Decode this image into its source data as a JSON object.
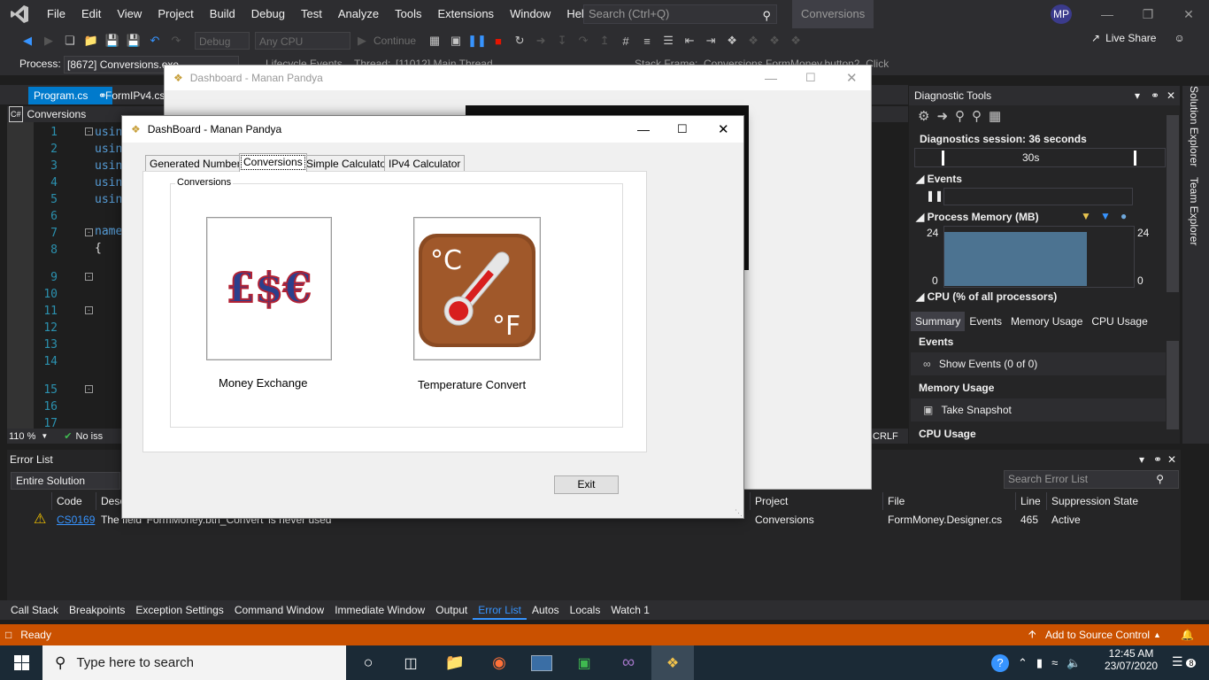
{
  "vs": {
    "menu": [
      "File",
      "Edit",
      "View",
      "Project",
      "Build",
      "Debug",
      "Test",
      "Analyze",
      "Tools",
      "Extensions",
      "Window",
      "Help"
    ],
    "search_placeholder": "Search (Ctrl+Q)",
    "solution_name": "Conversions",
    "user_initials": "MP",
    "live_share": "Live Share",
    "toolbar": {
      "config": "Debug",
      "platform": "Any CPU",
      "continue": "Continue"
    },
    "process_label": "Process:",
    "process_value": "[8672] Conversions.exe",
    "process_bar_extra": {
      "lifecycle": "Lifecycle Events",
      "thread_label": "Thread:",
      "thread_value": "[11012] Main Thread",
      "stack_label": "Stack Frame:",
      "stack_value": "Conversions.FormMoney.button2_Click"
    },
    "doc_tabs": [
      "Program.cs",
      "FormIPv4.cs"
    ],
    "nav_project": "Conversions",
    "editor": {
      "lines": [
        "1",
        "2",
        "3",
        "4",
        "5",
        "6",
        "7",
        "8",
        "9",
        "10",
        "11",
        "12",
        "13",
        "14",
        "15",
        "16",
        "17"
      ],
      "code": [
        "usin",
        "usin",
        "usin",
        "usin",
        "usin",
        "",
        "name",
        "{"
      ],
      "zoom": "110 %",
      "issues": "No iss",
      "line_ending": "CRLF"
    },
    "diag": {
      "title": "Diagnostic Tools",
      "session": "Diagnostics session: 36 seconds",
      "timeline_label": "30s",
      "events": "Events",
      "process_memory": "Process Memory (MB)",
      "mem_max": "24",
      "mem_min": "0",
      "memory_used_fraction": 0.88,
      "cpu": "CPU (% of all processors)",
      "tabs": [
        "Summary",
        "Events",
        "Memory Usage",
        "CPU Usage"
      ],
      "section_events": "Events",
      "show_events": "Show Events (0 of 0)",
      "section_memory": "Memory Usage",
      "take_snapshot": "Take Snapshot",
      "section_cpu": "CPU Usage"
    },
    "side_tabs": [
      "Solution Explorer",
      "Team Explorer"
    ],
    "error_list": {
      "title": "Error List",
      "scope": "Entire Solution",
      "search_placeholder": "Search Error List",
      "columns": {
        "code": "Code",
        "description": "Desc",
        "project": "Project",
        "file": "File",
        "line": "Line",
        "suppression": "Suppression State"
      },
      "row": {
        "code": "CS0169",
        "description": "The field 'FormMoney.btn_Convert' is never used",
        "project": "Conversions",
        "file": "FormMoney.Designer.cs",
        "line": "465",
        "suppression": "Active"
      }
    },
    "bottom_tabs": [
      "Call Stack",
      "Breakpoints",
      "Exception Settings",
      "Command Window",
      "Immediate Window",
      "Output",
      "Error List",
      "Autos",
      "Locals",
      "Watch 1"
    ],
    "status": {
      "ready": "Ready",
      "source_control": "Add to Source Control"
    }
  },
  "dashboard_back": {
    "title": "Dashboard - Manan Pandya"
  },
  "dashboard": {
    "title": "DashBoard - Manan Pandya",
    "tabs": [
      "Generated Numbers",
      "Conversions",
      "Simple Calculator",
      "IPv4 Calculator"
    ],
    "active_tab": "Conversions",
    "group_title": "Conversions",
    "money_label": "Money Exchange",
    "temp_label": "Temperature Convert",
    "money_icon_text": "£$€",
    "temp_c": "°C",
    "temp_f": "°F",
    "exit_label": "Exit"
  },
  "taskbar": {
    "search_placeholder": "Type here to search",
    "time": "12:45 AM",
    "date": "23/07/2020",
    "notification_count": "8"
  }
}
